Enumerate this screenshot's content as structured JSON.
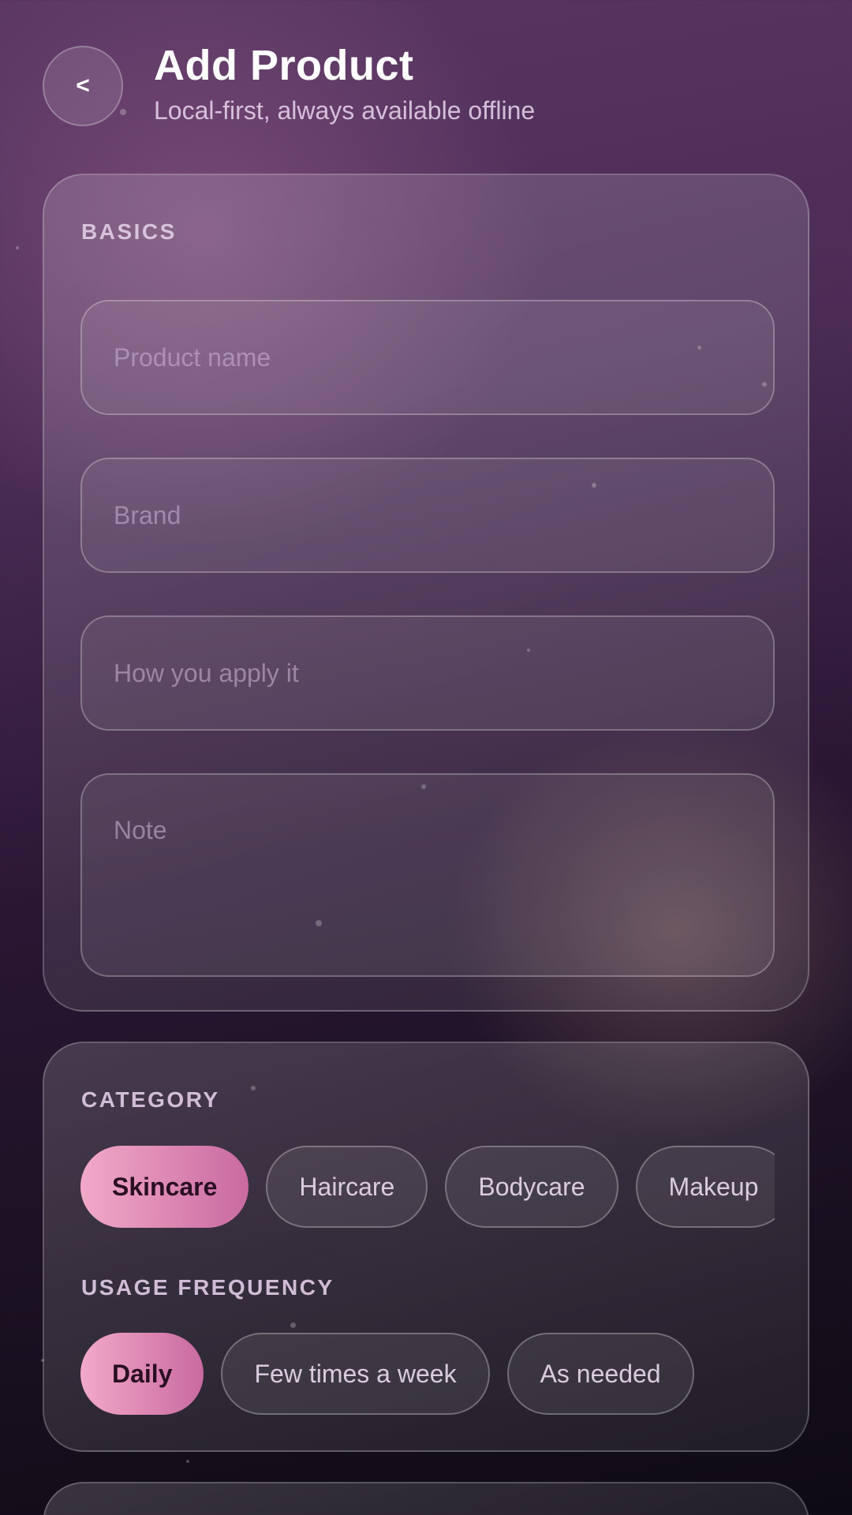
{
  "header": {
    "back_label": "<",
    "title": "Add Product",
    "subtitle": "Local-first, always available offline"
  },
  "basics": {
    "section_label": "BASICS",
    "fields": {
      "product_name": {
        "placeholder": "Product name",
        "value": ""
      },
      "brand": {
        "placeholder": "Brand",
        "value": ""
      },
      "application": {
        "placeholder": "How you apply it",
        "value": ""
      },
      "note": {
        "placeholder": "Note",
        "value": ""
      }
    }
  },
  "category": {
    "section_label": "CATEGORY",
    "options": [
      "Skincare",
      "Haircare",
      "Bodycare",
      "Makeup"
    ],
    "selected": "Skincare"
  },
  "usage_frequency": {
    "section_label": "USAGE FREQUENCY",
    "options": [
      "Daily",
      "Few times a week",
      "As needed"
    ],
    "selected": "Daily"
  },
  "colors": {
    "accent_start": "#f2a9c8",
    "accent_end": "#c96aa0",
    "background_top": "#5a3663",
    "background_bottom": "#0e0a14"
  },
  "icons": {
    "back": "chevron-left-icon"
  }
}
